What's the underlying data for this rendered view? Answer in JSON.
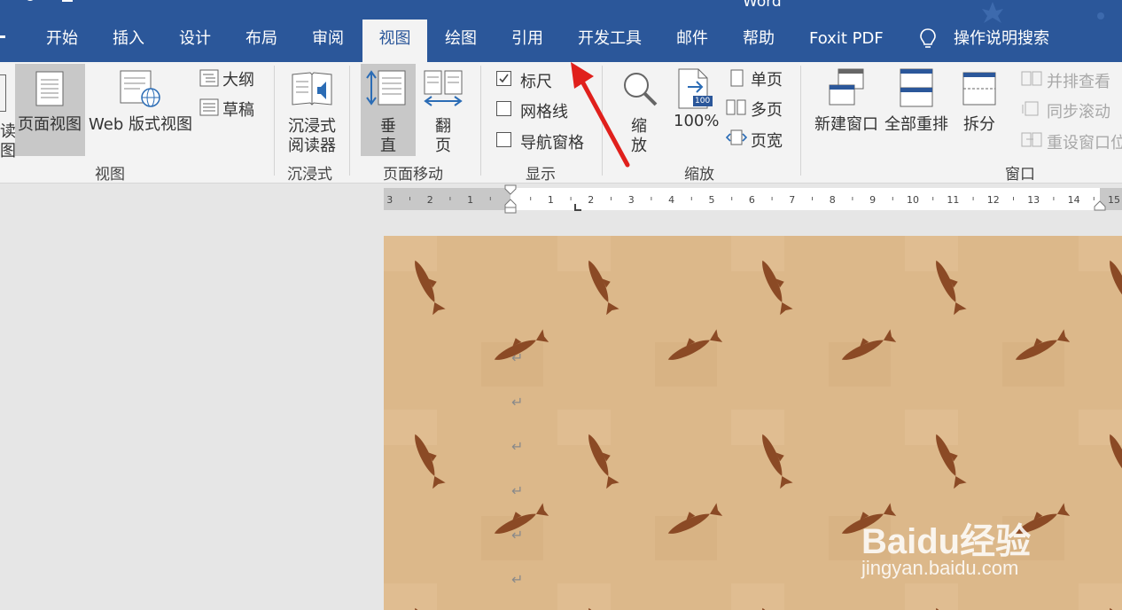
{
  "window": {
    "title": "Word"
  },
  "tabs": [
    {
      "label": "开始"
    },
    {
      "label": "插入"
    },
    {
      "label": "设计"
    },
    {
      "label": "布局"
    },
    {
      "label": "审阅"
    },
    {
      "label": "视图",
      "active": true
    },
    {
      "label": "绘图"
    },
    {
      "label": "引用"
    },
    {
      "label": "开发工具"
    },
    {
      "label": "邮件"
    },
    {
      "label": "帮助"
    },
    {
      "label": "Foxit PDF"
    }
  ],
  "tell_me": {
    "label": "操作说明搜索"
  },
  "ribbon": {
    "views": {
      "label": "视图",
      "print_layout": "页面视图",
      "web_layout": "Web 版式视图",
      "outline": "大纲",
      "draft": "草稿"
    },
    "immersive": {
      "label": "沉浸式",
      "reader_line1": "沉浸式",
      "reader_line2": "阅读器"
    },
    "page_movement": {
      "label": "页面移动",
      "vertical_1": "垂",
      "vertical_2": "直",
      "side_1": "翻",
      "side_2": "页"
    },
    "show": {
      "label": "显示",
      "ruler": "标尺",
      "ruler_checked": true,
      "gridlines": "网格线",
      "gridlines_checked": false,
      "nav_pane": "导航窗格",
      "nav_pane_checked": false
    },
    "zoom": {
      "label": "缩放",
      "zoom_1": "缩",
      "zoom_2": "放",
      "hundred": "100%",
      "hundred_badge": "100",
      "one_page": "单页",
      "multiple_pages": "多页",
      "page_width": "页宽"
    },
    "window": {
      "label": "窗口",
      "new_window": "新建窗口",
      "arrange_all": "全部重排",
      "split": "拆分",
      "side_by_side": "并排查看",
      "sync_scroll": "同步滚动",
      "reset_position": "重设窗口位"
    }
  },
  "ruler": {
    "left_ticks": [
      "3",
      "2",
      "1"
    ],
    "right_ticks": [
      "1",
      "2",
      "3",
      "4",
      "5",
      "6",
      "7",
      "8",
      "9",
      "10",
      "11",
      "12",
      "13",
      "14",
      "15"
    ]
  },
  "document": {
    "paragraph_mark": "↵"
  },
  "watermark": {
    "brand": "Baidu经验",
    "url": "jingyan.baidu.com"
  },
  "colors": {
    "title_bar": "#2b579a",
    "ribbon_bg": "#f3f3f3",
    "active_tab_text": "#2b579a",
    "page_bg": "#dcb88a",
    "fish": "#8b4a25",
    "annotation_arrow": "#e0201c"
  }
}
